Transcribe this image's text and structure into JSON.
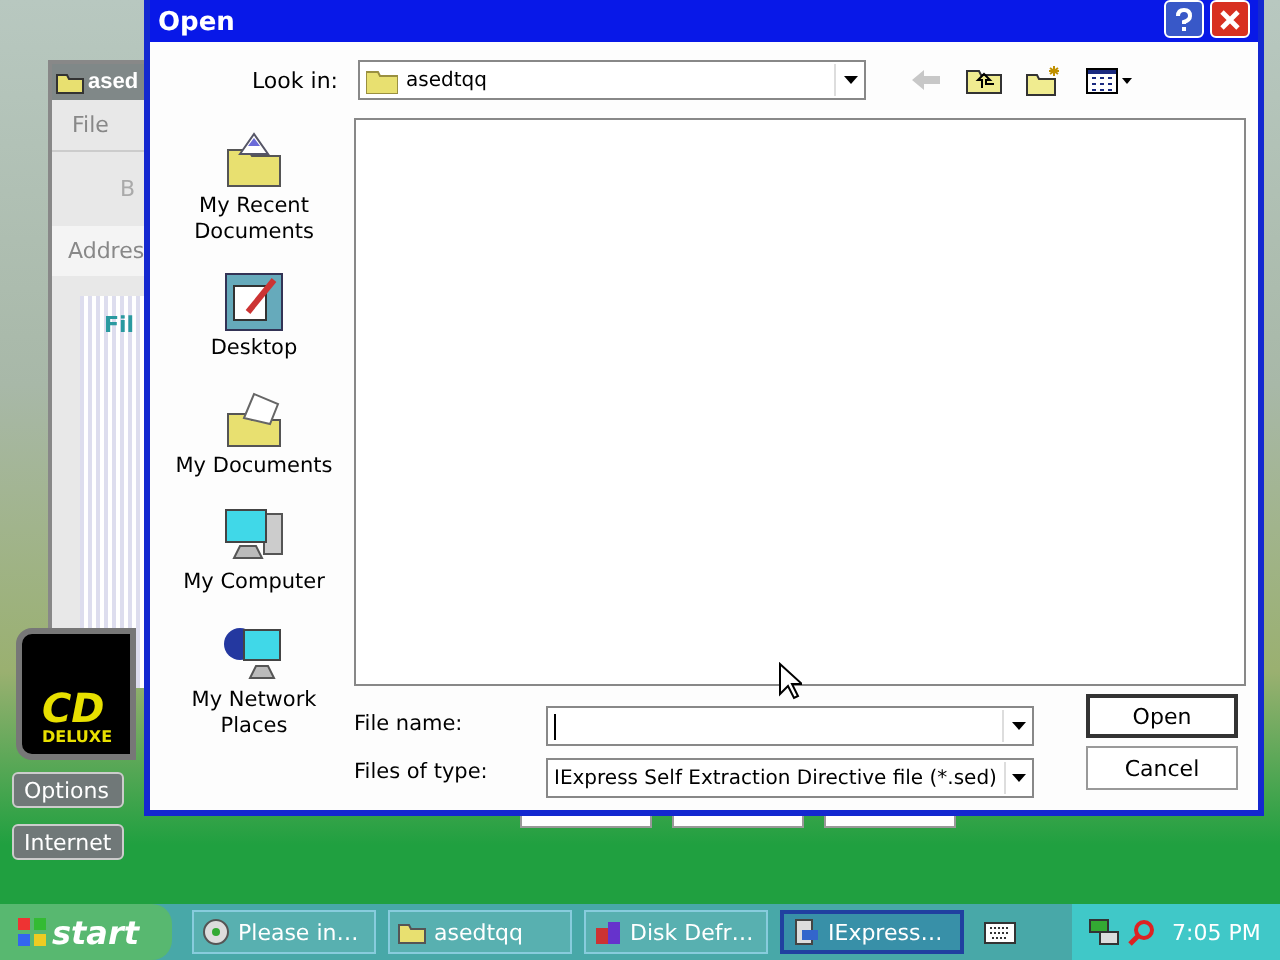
{
  "background": {
    "window_title": "ased",
    "menu": "File",
    "nav": "B",
    "address_label": "Addres",
    "panel_title": "Fil",
    "logo": {
      "big": "CD",
      "small": "DELUXE"
    },
    "side_buttons": [
      "Options",
      "Internet"
    ]
  },
  "dialog": {
    "title": "Open",
    "look_in_label": "Look in:",
    "look_in_value": "asedtqq",
    "places": [
      {
        "label": "My Recent Documents",
        "kind": "recent"
      },
      {
        "label": "Desktop",
        "kind": "desktop"
      },
      {
        "label": "My Documents",
        "kind": "documents"
      },
      {
        "label": "My Computer",
        "kind": "computer"
      },
      {
        "label": "My Network Places",
        "kind": "network"
      }
    ],
    "file_name_label": "File name:",
    "files_of_type_label": "Files of type:",
    "files_of_type_value": "IExpress Self Extraction Directive file (*.sed)",
    "buttons": [
      "Open",
      "Cancel"
    ]
  },
  "taskbar": {
    "start": "start",
    "tasks": [
      {
        "label": "Please in…",
        "kind": "setup",
        "selected": false
      },
      {
        "label": "asedtqq",
        "kind": "folder",
        "selected": false
      },
      {
        "label": "Disk Defr…",
        "kind": "defrag",
        "selected": false
      },
      {
        "label": "IExpress…",
        "kind": "installer",
        "selected": true
      }
    ],
    "clock": "7:05 PM"
  }
}
